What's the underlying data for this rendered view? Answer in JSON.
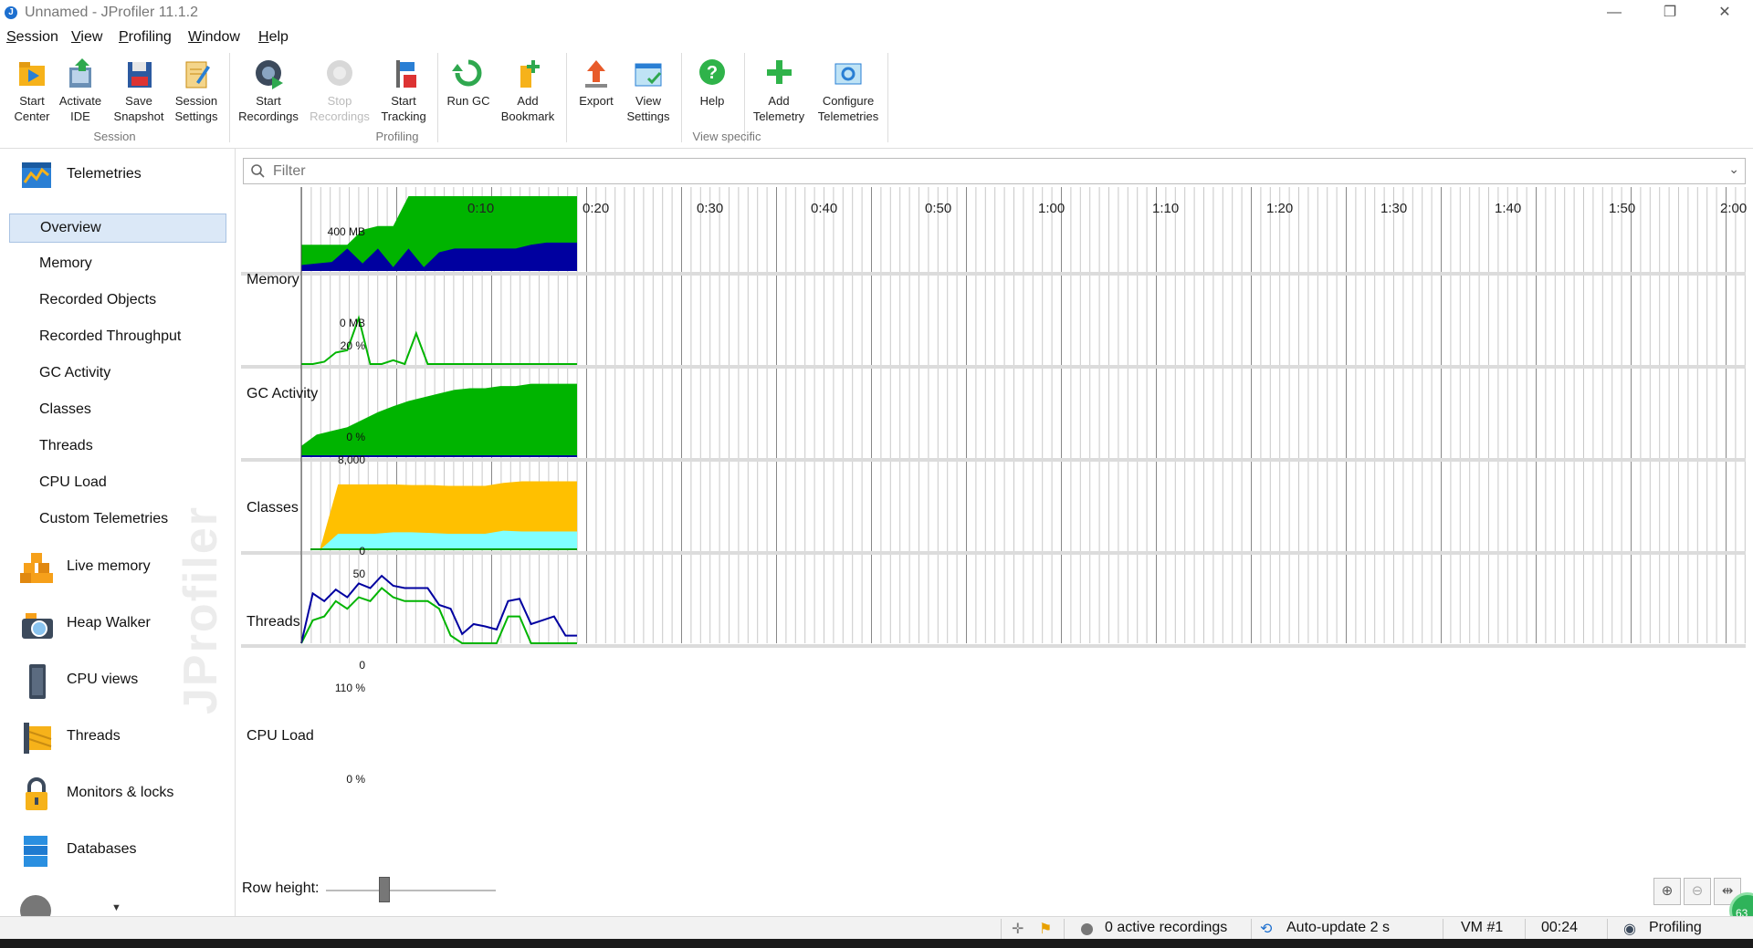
{
  "window": {
    "title": "Unnamed - JProfiler 11.1.2",
    "controls": [
      "—",
      "❐",
      "✕"
    ]
  },
  "menu": [
    "Session",
    "View",
    "Profiling",
    "Window",
    "Help"
  ],
  "toolbar": {
    "buttons": [
      {
        "line1": "Start",
        "line2": "Center",
        "icon": "start-center-icon"
      },
      {
        "line1": "Activate",
        "line2": "IDE",
        "icon": "activate-ide-icon"
      },
      {
        "line1": "Save",
        "line2": "Snapshot",
        "icon": "save-snapshot-icon"
      },
      {
        "line1": "Session",
        "line2": "Settings",
        "icon": "session-settings-icon"
      },
      {
        "line1": "Start",
        "line2": "Recordings",
        "icon": "start-recordings-icon"
      },
      {
        "line1": "Stop",
        "line2": "Recordings",
        "icon": "stop-recordings-icon",
        "disabled": true
      },
      {
        "line1": "Start",
        "line2": "Tracking",
        "icon": "start-tracking-icon"
      },
      {
        "line1": "Run GC",
        "line2": "",
        "icon": "run-gc-icon"
      },
      {
        "line1": "Add",
        "line2": "Bookmark",
        "icon": "add-bookmark-icon"
      },
      {
        "line1": "Export",
        "line2": "",
        "icon": "export-icon"
      },
      {
        "line1": "View",
        "line2": "Settings",
        "icon": "view-settings-icon"
      },
      {
        "line1": "Help",
        "line2": "",
        "icon": "help-icon"
      },
      {
        "line1": "Add",
        "line2": "Telemetry",
        "icon": "add-telemetry-icon"
      },
      {
        "line1": "Configure",
        "line2": "Telemetries",
        "icon": "configure-telemetries-icon"
      }
    ],
    "groups": [
      "Session",
      "Profiling",
      "View specific"
    ]
  },
  "sidebar": {
    "telemetries_label": "Telemetries",
    "sub_items": [
      "Overview",
      "Memory",
      "Recorded Objects",
      "Recorded Throughput",
      "GC Activity",
      "Classes",
      "Threads",
      "CPU Load",
      "Custom Telemetries"
    ],
    "selected": "Overview",
    "sections": [
      {
        "label": "Live memory",
        "icon": "live-memory-icon"
      },
      {
        "label": "Heap Walker",
        "icon": "heap-walker-icon"
      },
      {
        "label": "CPU views",
        "icon": "cpu-views-icon"
      },
      {
        "label": "Threads",
        "icon": "threads-icon"
      },
      {
        "label": "Monitors & locks",
        "icon": "monitors-locks-icon"
      },
      {
        "label": "Databases",
        "icon": "databases-icon"
      }
    ],
    "watermark": "JProfiler"
  },
  "filter": {
    "placeholder": "Filter"
  },
  "timeline": {
    "labels": [
      "0:10",
      "0:20",
      "0:30",
      "0:40",
      "0:50",
      "1:00",
      "1:10",
      "1:20",
      "1:30",
      "1:40",
      "1:50",
      "2:00"
    ]
  },
  "rows": [
    {
      "label": "Memory",
      "top_scale": "400 MB",
      "bottom_scale": "0 MB"
    },
    {
      "label": "GC Activity",
      "top_scale": "20 %",
      "bottom_scale": "0 %"
    },
    {
      "label": "Classes",
      "top_scale": "8,000",
      "bottom_scale": "0"
    },
    {
      "label": "Threads",
      "top_scale": "50",
      "bottom_scale": "0"
    },
    {
      "label": "CPU Load",
      "top_scale": "110 %",
      "bottom_scale": "0 %"
    }
  ],
  "colors": {
    "green": "#00b400",
    "navy": "#0000a0",
    "orange": "#ffc000",
    "cyan": "#80ffff",
    "selection": "#dbe8f7"
  },
  "row_height_label": "Row height:",
  "status": {
    "recordings": "0 active recordings",
    "autoupdate": "Auto-update 2 s",
    "vm": "VM #1",
    "time": "00:24",
    "mode": "Profiling",
    "badge": "63"
  }
}
